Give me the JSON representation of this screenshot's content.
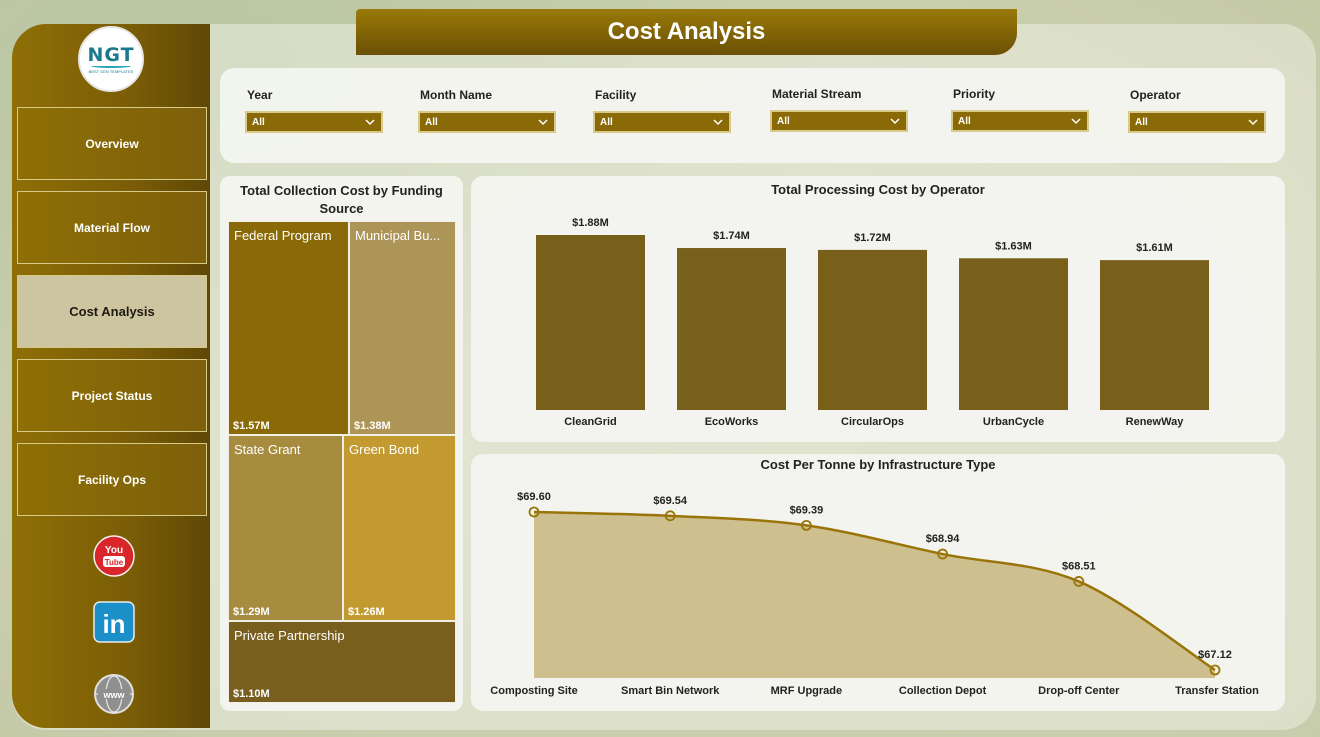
{
  "header": {
    "title": "Cost Analysis"
  },
  "logo": {
    "text": "NGT",
    "subtext": "BEST GEN TEMPLATES"
  },
  "sidebar": {
    "items": [
      {
        "label": "Overview",
        "active": false
      },
      {
        "label": "Material Flow",
        "active": false
      },
      {
        "label": "Cost Analysis",
        "active": true
      },
      {
        "label": "Project Status",
        "active": false
      },
      {
        "label": "Facility Ops",
        "active": false
      }
    ],
    "social": [
      {
        "icon": "youtube-icon",
        "text": "You Tube"
      },
      {
        "icon": "linkedin-icon",
        "text": "in"
      },
      {
        "icon": "www-icon",
        "text": "www"
      }
    ]
  },
  "filters": [
    {
      "label": "Year",
      "value": "All"
    },
    {
      "label": "Month Name",
      "value": "All"
    },
    {
      "label": "Facility",
      "value": "All"
    },
    {
      "label": "Material Stream",
      "value": "All"
    },
    {
      "label": "Priority",
      "value": "All"
    },
    {
      "label": "Operator",
      "value": "All"
    }
  ],
  "colors": {
    "accent": "#8a6a06",
    "bar": "#78601a",
    "line": "#9a7408",
    "area": "#cdbf8e",
    "tm_federal": "#8a6a06",
    "tm_municipal": "#ad9457",
    "tm_state": "#a78c40",
    "tm_green": "#c29a30",
    "tm_private": "#785f1e"
  },
  "chart_data": [
    {
      "type": "treemap",
      "title": "Total Collection Cost by Funding Source",
      "items": [
        {
          "name": "Federal Program",
          "display_name": "Federal Program",
          "value": 1.57,
          "label": "$1.57M"
        },
        {
          "name": "Municipal Budget",
          "display_name": "Municipal Bu...",
          "value": 1.38,
          "label": "$1.38M"
        },
        {
          "name": "State Grant",
          "display_name": "State Grant",
          "value": 1.29,
          "label": "$1.29M"
        },
        {
          "name": "Green Bond",
          "display_name": "Green Bond",
          "value": 1.26,
          "label": "$1.26M"
        },
        {
          "name": "Private Partnership",
          "display_name": "Private Partnership",
          "value": 1.1,
          "label": "$1.10M"
        }
      ]
    },
    {
      "type": "bar",
      "title": "Total Processing Cost by Operator",
      "categories": [
        "CleanGrid",
        "EcoWorks",
        "CircularOps",
        "UrbanCycle",
        "RenewWay"
      ],
      "values": [
        1.88,
        1.74,
        1.72,
        1.63,
        1.61
      ],
      "labels": [
        "$1.88M",
        "$1.74M",
        "$1.72M",
        "$1.63M",
        "$1.61M"
      ],
      "ylim": [
        0,
        1.88
      ]
    },
    {
      "type": "area",
      "title": "Cost Per Tonne by Infrastructure Type",
      "categories": [
        "Composting Site",
        "Smart Bin Network",
        "MRF Upgrade",
        "Collection Depot",
        "Drop-off Center",
        "Transfer Station"
      ],
      "values": [
        69.6,
        69.54,
        69.39,
        68.94,
        68.51,
        67.12
      ],
      "labels": [
        "$69.60",
        "$69.54",
        "$69.39",
        "$68.94",
        "$68.51",
        "$67.12"
      ],
      "ylim": [
        67.12,
        69.6
      ]
    }
  ]
}
